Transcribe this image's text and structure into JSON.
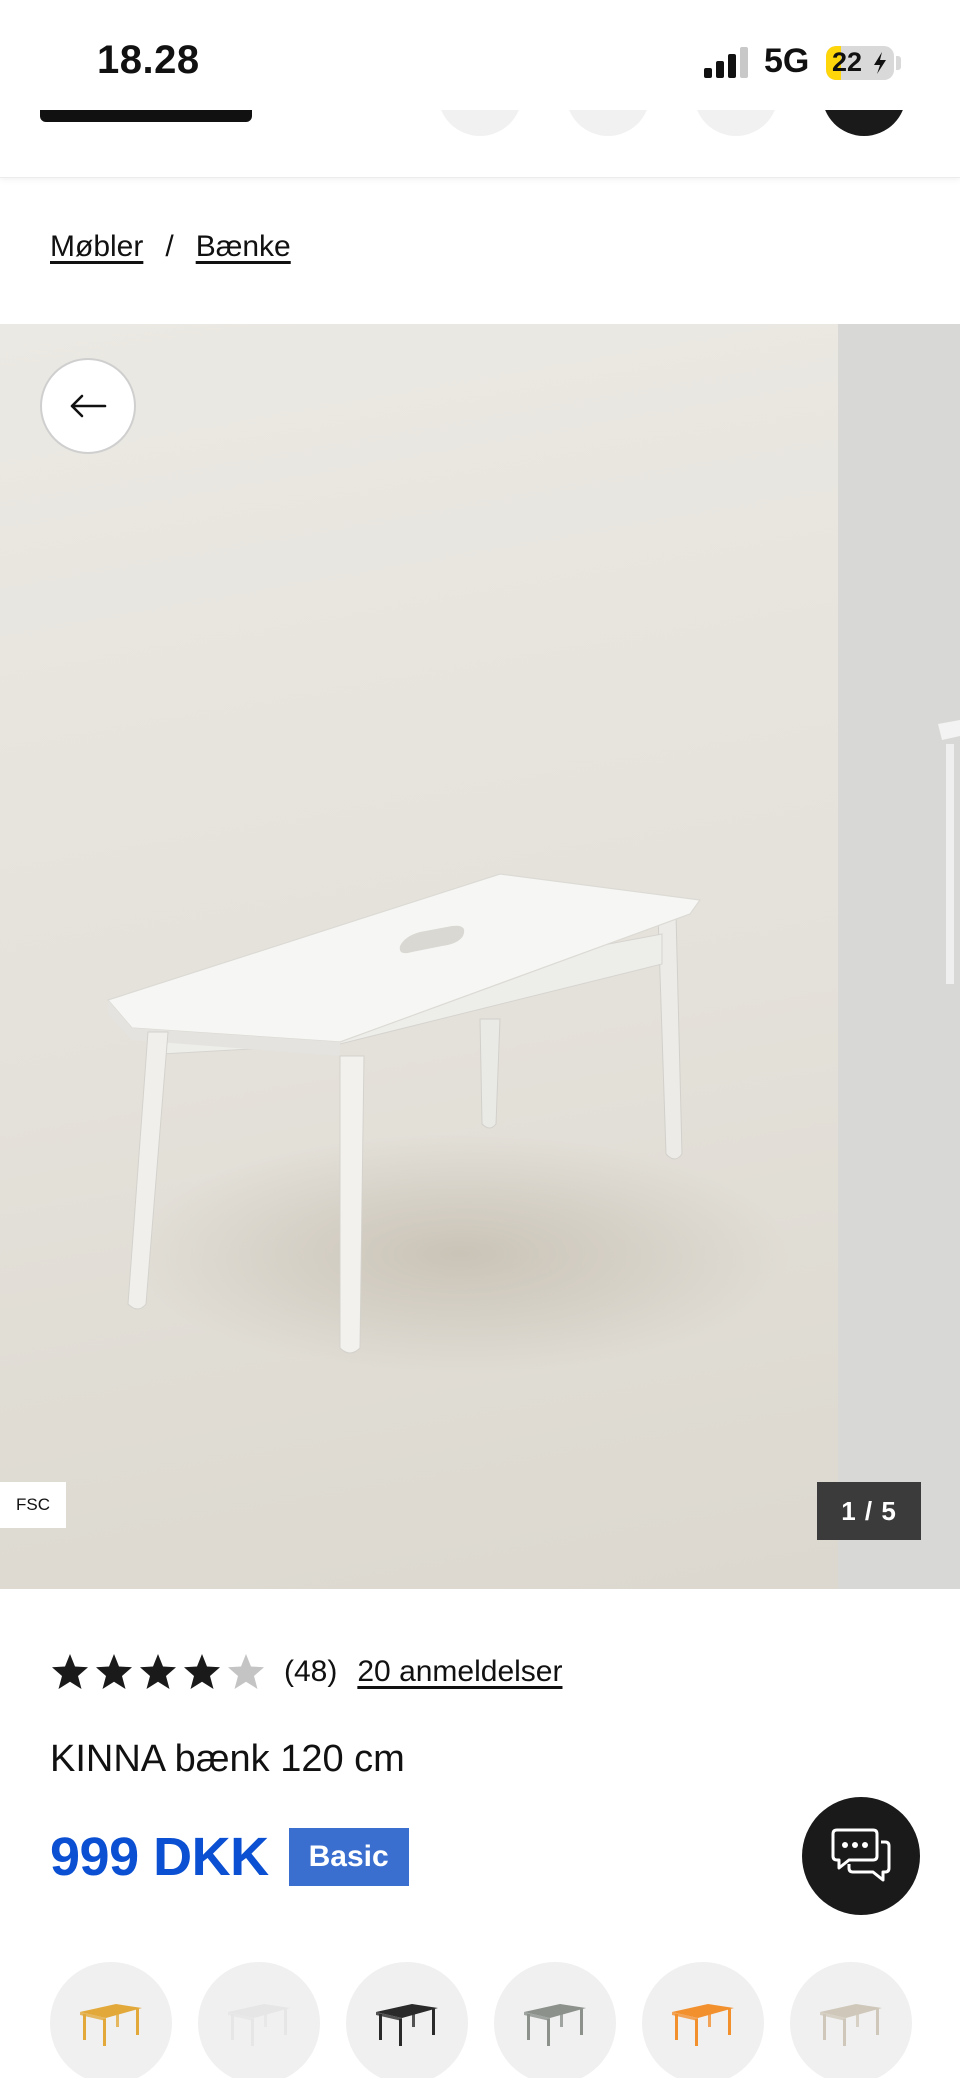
{
  "status_bar": {
    "time": "18.28",
    "network": "5G",
    "battery": "22",
    "battery_level": 0.22
  },
  "breadcrumb": {
    "items": [
      "Møbler",
      "Bænke"
    ],
    "separator": "/"
  },
  "gallery": {
    "badge": "FSC",
    "counter": "1 / 5"
  },
  "product": {
    "rating_value": 4,
    "rating_max": 5,
    "rating_count": "(48)",
    "reviews_link": "20 anmeldelser",
    "title": "KINNA bænk 120 cm",
    "price": "999 DKK",
    "tag": "Basic"
  },
  "swatches": [
    {
      "name": "yellow",
      "color": "#e2a93a"
    },
    {
      "name": "white",
      "color": "#e6e6e6"
    },
    {
      "name": "black",
      "color": "#2a2a2a"
    },
    {
      "name": "grey-green",
      "color": "#8c918c"
    },
    {
      "name": "orange",
      "color": "#f2902e"
    },
    {
      "name": "beige",
      "color": "#cfc8ba"
    }
  ],
  "colors": {
    "price": "#0b50d2",
    "tag_bg": "#3a6fd0",
    "star_filled": "#1a1a1a",
    "star_empty": "#c4c4c4"
  }
}
